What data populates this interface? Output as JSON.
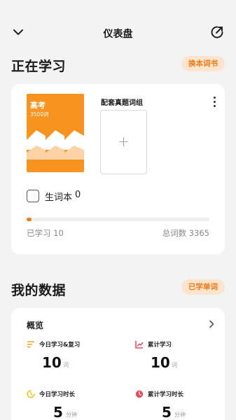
{
  "header": {
    "title": "仪表盘"
  },
  "studying": {
    "section_title": "正在学习",
    "change_book_label": "换本词书",
    "book": {
      "title": "高考",
      "word_count": "3500词"
    },
    "combo_title": "配套真题词组",
    "add_symbol": "+",
    "vocab_label": "生词本",
    "vocab_count": "0",
    "progress": {
      "learned_label": "已学习 10",
      "total_label": "总词数 3365",
      "learned": 10,
      "total": 3365
    }
  },
  "my_data": {
    "section_title": "我的数据",
    "learned_words_label": "已学单词",
    "overview_label": "概览",
    "stats": [
      {
        "label": "今日学习&复习",
        "value": "10",
        "unit": "词",
        "icon": "list-icon",
        "color": "#f5a623"
      },
      {
        "label": "累计学习",
        "value": "10",
        "unit": "词",
        "icon": "trend-chart-icon",
        "color": "#e74c5b"
      },
      {
        "label": "今日学习时长",
        "value": "5",
        "unit": "分钟",
        "icon": "clock-icon",
        "color": "#f5c518"
      },
      {
        "label": "累计学习时长",
        "value": "5",
        "unit": "分钟",
        "icon": "timer-icon",
        "color": "#e74c5b"
      }
    ]
  },
  "colors": {
    "accent": "#f07a12",
    "pill_bg": "#fde4cf",
    "book_orange": "#f7931e"
  }
}
